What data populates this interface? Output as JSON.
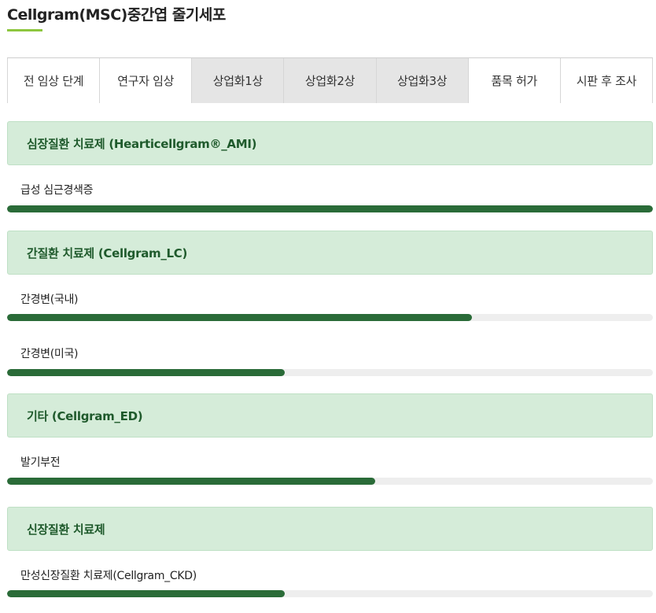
{
  "page_title": "Cellgram(MSC)중간엽 줄기세포",
  "colors": {
    "accent": "#8dc63f",
    "header_bg": "#d5ecd9",
    "header_text": "#1f5a2c",
    "bar_fill": "#2a6b38",
    "bar_track": "#eeeeee"
  },
  "tabs": [
    {
      "label": "전 임상 단계",
      "active": false
    },
    {
      "label": "연구자 임상",
      "active": false
    },
    {
      "label": "상업화1상",
      "active": true
    },
    {
      "label": "상업화2상",
      "active": true
    },
    {
      "label": "상업화3상",
      "active": true
    },
    {
      "label": "품목 허가",
      "active": false
    },
    {
      "label": "시판 후 조사",
      "active": false
    }
  ],
  "sections": [
    {
      "title": "심장질환 치료제 (Hearticellgram®_AMI)",
      "items": [
        {
          "label": "급성 심근경색증",
          "progress": 1.0
        }
      ]
    },
    {
      "title": "간질환 치료제 (Cellgram_LC)",
      "items": [
        {
          "label": "간경변(국내)",
          "progress": 0.72
        },
        {
          "label": "간경변(미국)",
          "progress": 0.43
        }
      ]
    },
    {
      "title": "기타 (Cellgram_ED)",
      "items": [
        {
          "label": "발기부전",
          "progress": 0.57
        }
      ]
    },
    {
      "title": "신장질환 치료제",
      "items": [
        {
          "label": "만성신장질환 치료제(Cellgram_CKD)",
          "progress": 0.43
        }
      ]
    }
  ]
}
